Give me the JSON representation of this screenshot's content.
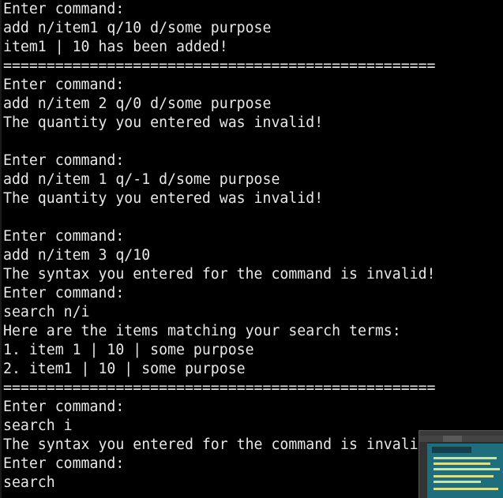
{
  "terminal": {
    "lines": [
      "Enter command:",
      "add n/item1 q/10 d/some purpose",
      "item1 | 10 has been added!",
      "==================================================",
      "Enter command:",
      "add n/item 2 q/0 d/some purpose",
      "The quantity you entered was invalid!",
      "",
      "Enter command:",
      "add n/item 1 q/-1 d/some purpose",
      "The quantity you entered was invalid!",
      "",
      "Enter command:",
      "add n/item 3 q/10",
      "The syntax you entered for the command is invalid!",
      "Enter command:",
      "search n/i",
      "Here are the items matching your search terms:",
      "1. item 1 | 10 | some purpose",
      "2. item1 | 10 | some purpose",
      "==================================================",
      "Enter command:",
      "search i",
      "The syntax you entered for the command is invali",
      "Enter command:",
      "search"
    ]
  },
  "colors": {
    "background": "#000000",
    "text": "#e8e8e8"
  }
}
